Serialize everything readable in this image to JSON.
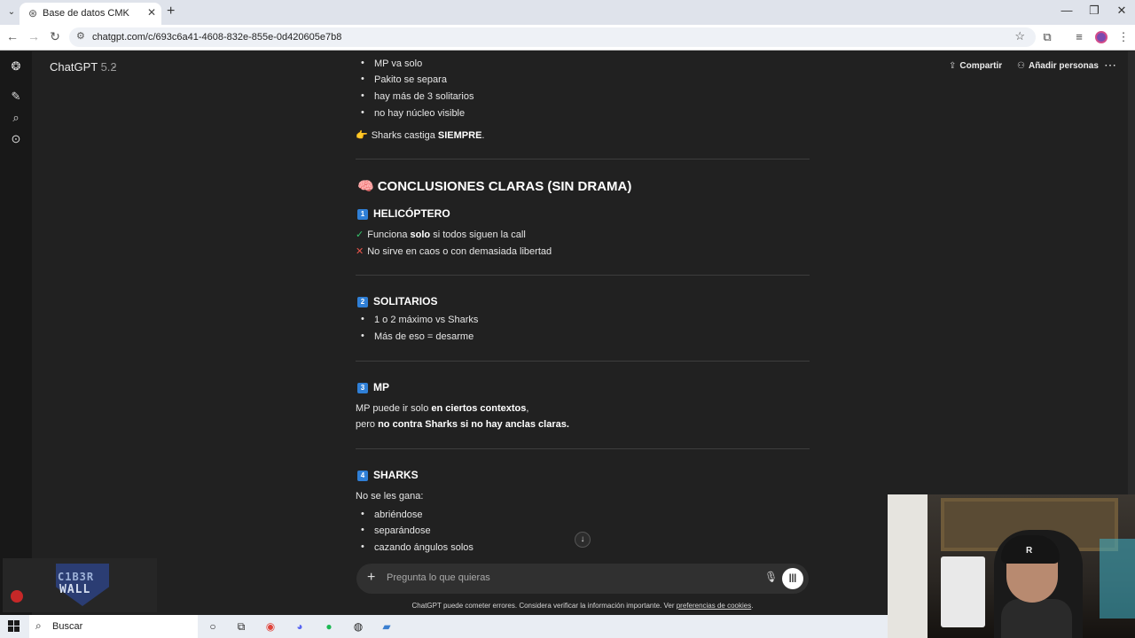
{
  "browser": {
    "tab_title": "Base de datos CMK",
    "url": "chatgpt.com/c/693c6a41-4608-832e-855e-0d420605e7b8"
  },
  "header": {
    "model_name": "ChatGPT",
    "model_version": "5.2",
    "share_label": "Compartir",
    "add_people_label": "Añadir personas"
  },
  "conversation": {
    "intro_bullets": [
      "MP va solo",
      "Pakito se separa",
      "hay más de 3 solitarios",
      "no hay núcleo visible"
    ],
    "sharks_emoji": "👉",
    "sharks_line_pre": "Sharks castiga ",
    "sharks_line_bold": "SIEMPRE",
    "sharks_line_post": ".",
    "conclusions_emoji": "🧠",
    "conclusions_title": "CONCLUSIONES CLARAS (SIN DRAMA)",
    "sec1": {
      "num": "1",
      "title": "HELICÓPTERO",
      "check_mark": "✓",
      "check_pre": "Funciona ",
      "check_bold": "solo",
      "check_post": " si todos siguen la call",
      "cross_mark": "✕",
      "cross_text": "No sirve en caos o con demasiada libertad"
    },
    "sec2": {
      "num": "2",
      "title": "SOLITARIOS",
      "bullets": [
        "1 o 2 máximo vs Sharks",
        "Más de eso = desarme"
      ]
    },
    "sec3": {
      "num": "3",
      "title": "MP",
      "line1_pre": "MP puede ir solo ",
      "line1_bold": "en ciertos contextos",
      "line1_post": ",",
      "line2_pre": "pero ",
      "line2_bold": "no contra Sharks si no hay anclas claras."
    },
    "sec4": {
      "num": "4",
      "title": "SHARKS",
      "intro": "No se les gana:",
      "bullets": [
        "abriéndose",
        "separándose",
        "cazando ángulos solos"
      ]
    }
  },
  "composer": {
    "placeholder": "Pregunta lo que quieras",
    "disclaimer": "ChatGPT puede cometer errores. Considera verificar la información importante. Ver ",
    "disclaimer_link": "preferencias de cookies",
    "disclaimer_end": "."
  },
  "overlay": {
    "logo_line1": "C1B3R",
    "logo_line2": "WALL",
    "cap_logo": "R"
  },
  "taskbar": {
    "search_label": "Buscar"
  },
  "colors": {
    "background": "#212121",
    "sidebar": "#181818",
    "accent_badge": "#2f7fd6",
    "check": "#36c46b",
    "cross": "#e8554b"
  }
}
